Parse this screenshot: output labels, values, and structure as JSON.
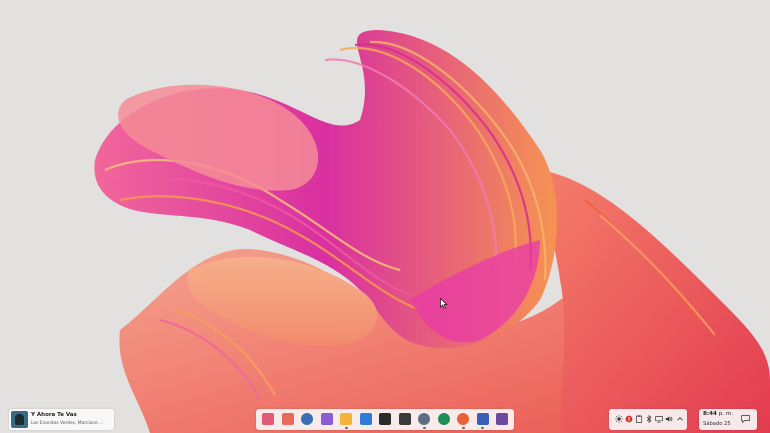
{
  "desktop": {
    "wallpaper": "abstract-ribbon-wallpaper"
  },
  "media_widget": {
    "title": "Y Ahora Te Vas",
    "artist": "Los Enanitos Verdes, Marciano ..."
  },
  "dock": {
    "apps": [
      {
        "name": "start-menu-icon",
        "color": "#e25a7a"
      },
      {
        "name": "task-view-icon",
        "color": "#e86a5a"
      },
      {
        "name": "search-icon",
        "color": "#3a6fb0"
      },
      {
        "name": "copilot-icon",
        "color": "#8a5cd6"
      },
      {
        "name": "file-explorer-icon",
        "color": "#f2b53a"
      },
      {
        "name": "microsoft-store-icon",
        "color": "#2f7bd8"
      },
      {
        "name": "terminal-icon",
        "color": "#2b2b2b"
      },
      {
        "name": "console-icon",
        "color": "#3a3a3a"
      },
      {
        "name": "settings-icon",
        "color": "#5b6e86"
      },
      {
        "name": "spotify-icon",
        "color": "#1f8f57"
      },
      {
        "name": "firefox-icon",
        "color": "#e8613a"
      },
      {
        "name": "edge-icon",
        "color": "#3b5fb8"
      },
      {
        "name": "media-app-icon",
        "color": "#6b4aa0"
      }
    ]
  },
  "tray": {
    "icons": [
      "brightness-icon",
      "record-icon",
      "clipboard-icon",
      "bluetooth-icon",
      "display-icon",
      "volume-icon",
      "chevron-up-icon"
    ]
  },
  "clock": {
    "time": "8:44",
    "ampm": "p. m.",
    "date": "Sábado 25"
  }
}
